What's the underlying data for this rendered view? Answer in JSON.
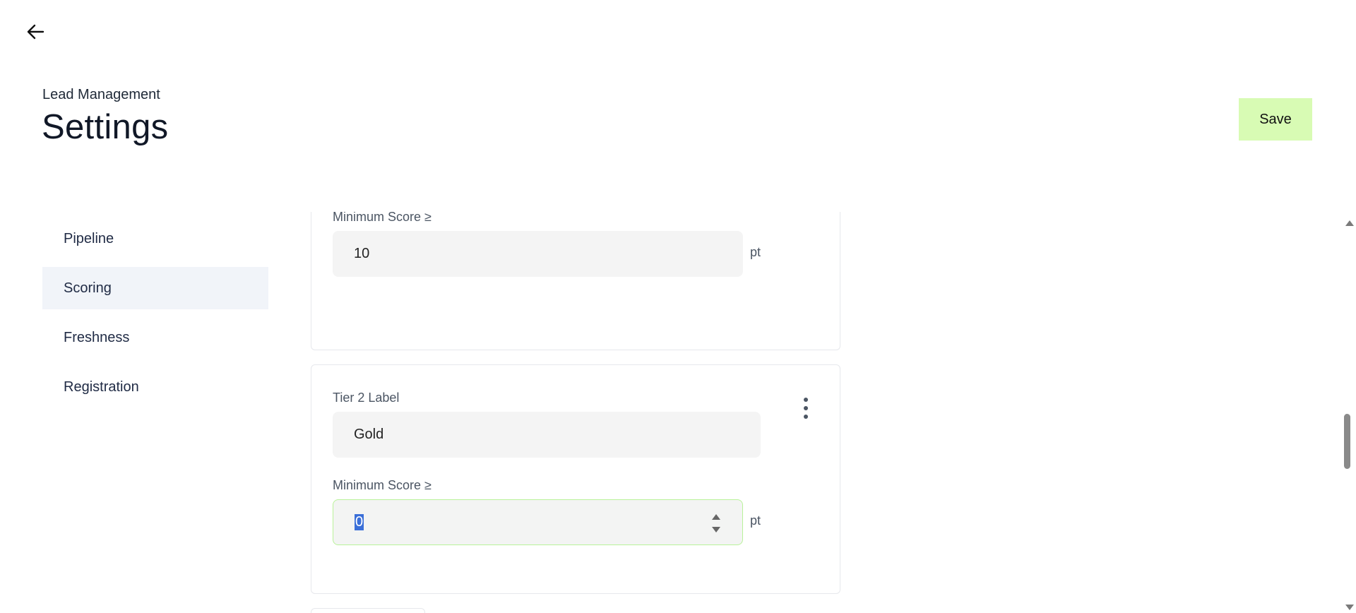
{
  "header": {
    "back_icon": "arrow-left-icon",
    "subtitle": "Lead Management",
    "title": "Settings",
    "save_label": "Save",
    "save_color": "#d8fbb4"
  },
  "sidebar": {
    "items": [
      {
        "label": "Pipeline",
        "active": false
      },
      {
        "label": "Scoring",
        "active": true
      },
      {
        "label": "Freshness",
        "active": false
      },
      {
        "label": "Registration",
        "active": false
      }
    ]
  },
  "tiers": {
    "tier1": {
      "min_score_label": "Minimum Score ≥",
      "min_score_value": "10",
      "unit": "pt"
    },
    "tier2": {
      "label_title": "Tier 2 Label",
      "label_value": "Gold",
      "min_score_label": "Minimum Score ≥",
      "min_score_value": "0",
      "unit": "pt",
      "menu_icon": "more-vertical-icon"
    }
  }
}
